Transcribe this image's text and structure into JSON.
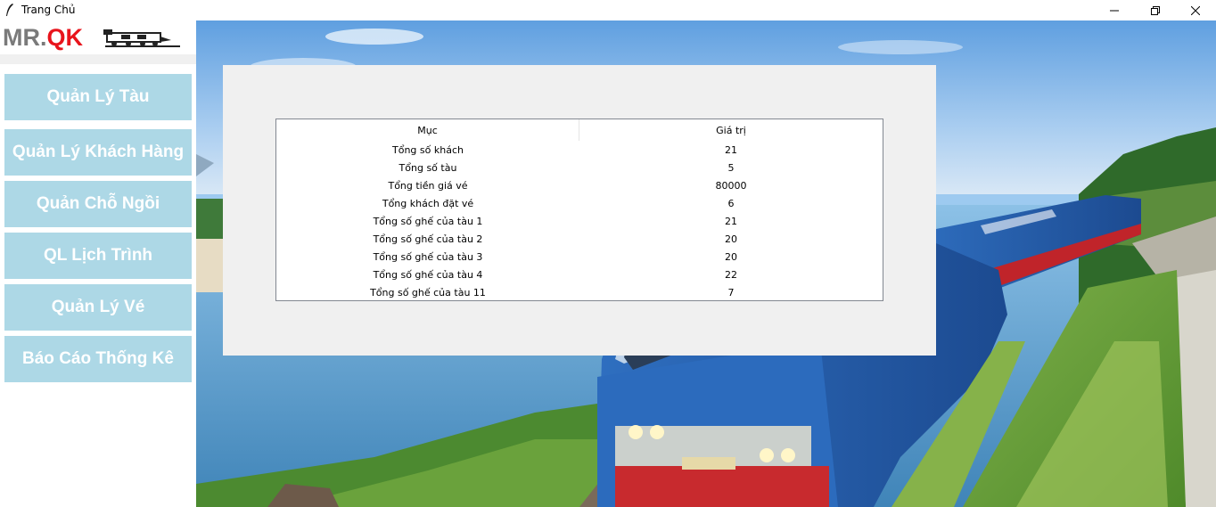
{
  "window": {
    "title": "Trang Chủ"
  },
  "logo": {
    "mr": "MR.",
    "qk": "QK"
  },
  "nav": {
    "items": [
      {
        "label": "Quản Lý Tàu"
      },
      {
        "label": "Quản Lý Khách Hàng"
      },
      {
        "label": "Quản Chỗ Ngồi"
      },
      {
        "label": "QL Lịch Trình"
      },
      {
        "label": "Quản Lý Vé"
      },
      {
        "label": "Báo Cáo Thống Kê"
      }
    ]
  },
  "stats": {
    "columns": [
      "Mục",
      "Giá trị"
    ],
    "rows": [
      {
        "label": "Tổng số khách",
        "value": "21"
      },
      {
        "label": "Tổng số tàu",
        "value": "5"
      },
      {
        "label": "Tổng tiền giá vé",
        "value": "80000"
      },
      {
        "label": "Tổng khách đặt vé",
        "value": "6"
      },
      {
        "label": "Tổng số ghế của tàu 1",
        "value": "21"
      },
      {
        "label": "Tổng số ghế của tàu 2",
        "value": "20"
      },
      {
        "label": "Tổng số ghế của tàu 3",
        "value": "20"
      },
      {
        "label": "Tổng số ghế của tàu 4",
        "value": "22"
      },
      {
        "label": "Tổng số ghế của tàu 11",
        "value": "7"
      }
    ]
  },
  "colors": {
    "nav_button_bg": "#add8e6",
    "nav_button_text": "#ffffff",
    "logo_gray": "#7a7a7a",
    "logo_red": "#e8141c",
    "frame_bg": "#f0f0f0"
  }
}
